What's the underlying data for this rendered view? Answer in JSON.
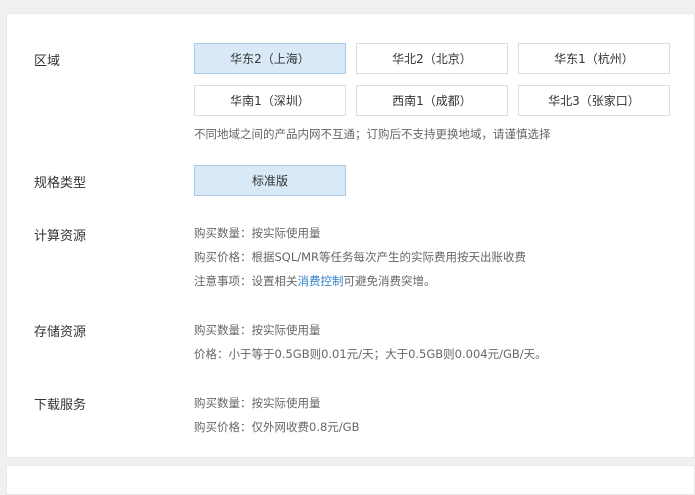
{
  "region": {
    "label": "区域",
    "options": [
      "华东2（上海）",
      "华北2（北京）",
      "华东1（杭州）",
      "华南1（深圳）",
      "西南1（成都）",
      "华北3（张家口）"
    ],
    "selected": "华东2（上海）",
    "note": "不同地域之间的产品内网不互通；订购后不支持更换地域，请谨慎选择"
  },
  "spec": {
    "label": "规格类型",
    "options": [
      "标准版"
    ],
    "selected": "标准版"
  },
  "compute": {
    "label": "计算资源",
    "quantity": "购买数量：按实际使用量",
    "price": "购买价格：根据SQL/MR等任务每次产生的实际费用按天出账收费",
    "notice_prefix": "注意事项：设置相关",
    "notice_link": "消费控制",
    "notice_suffix": "可避免消费突增。"
  },
  "storage": {
    "label": "存储资源",
    "quantity": "购买数量：按实际使用量",
    "price": "价格：小于等于0.5GB则0.01元/天；大于0.5GB则0.004元/GB/天。"
  },
  "download": {
    "label": "下载服务",
    "quantity": "购买数量：按实际使用量",
    "price": "购买价格：仅外网收费0.8元/GB"
  }
}
